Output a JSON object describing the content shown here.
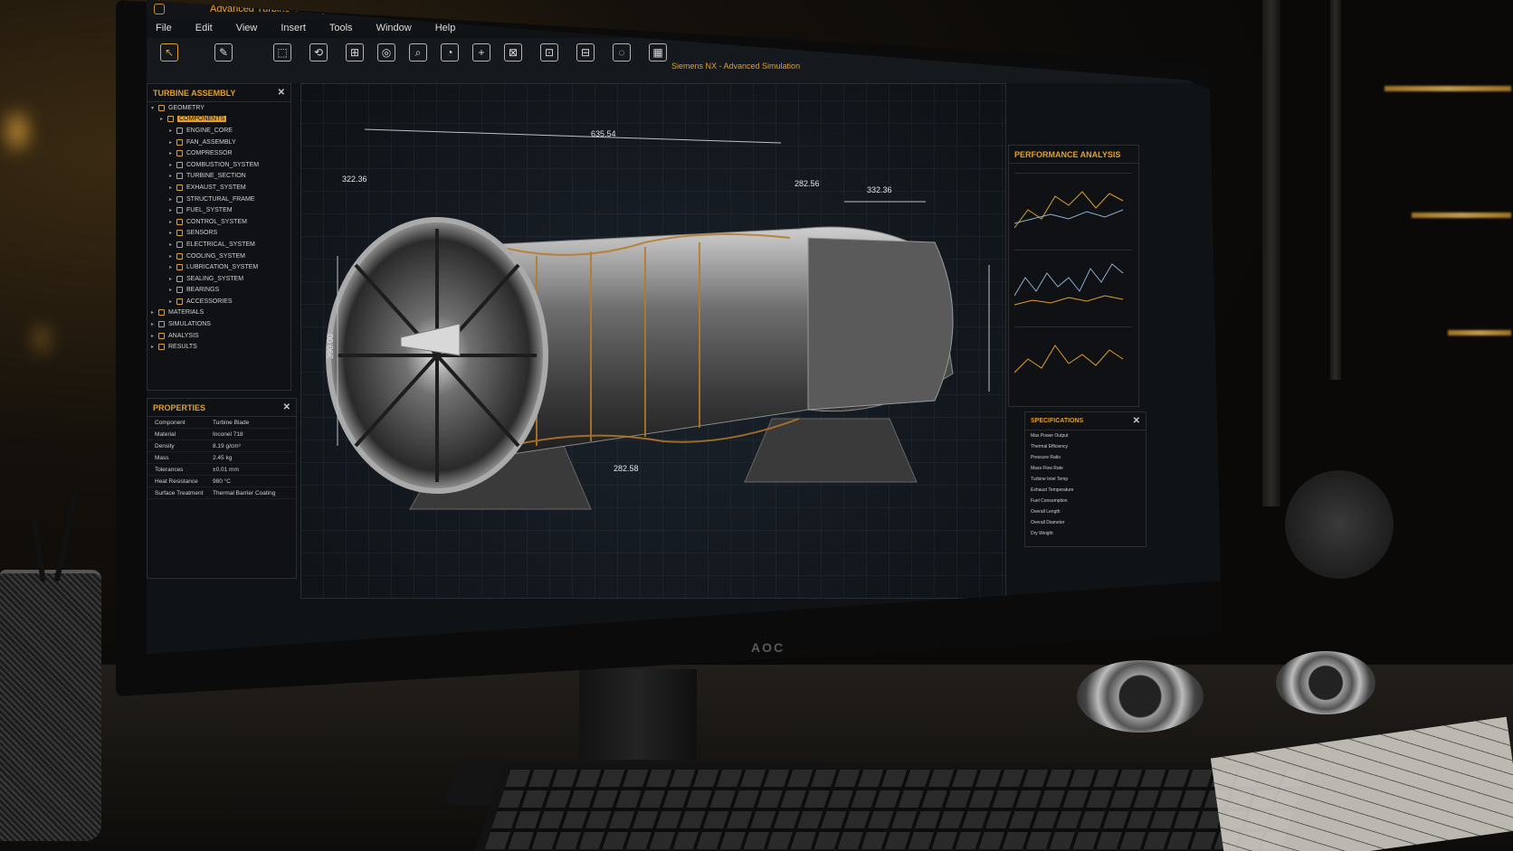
{
  "window": {
    "title": "Advanced Turbine Conceptual Design",
    "subtitle": "Siemens NX - Advanced Simulation"
  },
  "menu": [
    "File",
    "Edit",
    "View",
    "Insert",
    "Tools",
    "Window",
    "Help"
  ],
  "tree": {
    "title": "TURBINE ASSEMBLY",
    "items": [
      {
        "label": "GEOMETRY",
        "level": 0,
        "expanded": true
      },
      {
        "label": "COMPONENTS",
        "level": 1,
        "selected": true
      },
      {
        "label": "ENGINE_CORE",
        "level": 2
      },
      {
        "label": "FAN_ASSEMBLY",
        "level": 2
      },
      {
        "label": "COMPRESSOR",
        "level": 2
      },
      {
        "label": "COMBUSTION_SYSTEM",
        "level": 2
      },
      {
        "label": "TURBINE_SECTION",
        "level": 2
      },
      {
        "label": "EXHAUST_SYSTEM",
        "level": 2
      },
      {
        "label": "STRUCTURAL_FRAME",
        "level": 2
      },
      {
        "label": "FUEL_SYSTEM",
        "level": 2
      },
      {
        "label": "CONTROL_SYSTEM",
        "level": 2
      },
      {
        "label": "SENSORS",
        "level": 2
      },
      {
        "label": "ELECTRICAL_SYSTEM",
        "level": 2
      },
      {
        "label": "COOLING_SYSTEM",
        "level": 2
      },
      {
        "label": "LUBRICATION_SYSTEM",
        "level": 2
      },
      {
        "label": "SEALING_SYSTEM",
        "level": 2
      },
      {
        "label": "BEARINGS",
        "level": 2
      },
      {
        "label": "ACCESSORIES",
        "level": 2
      },
      {
        "label": "MATERIALS",
        "level": 0
      },
      {
        "label": "SIMULATIONS",
        "level": 0
      },
      {
        "label": "ANALYSIS",
        "level": 0
      },
      {
        "label": "RESULTS",
        "level": 0
      }
    ]
  },
  "properties": {
    "title": "PROPERTIES",
    "rows": [
      {
        "k": "Component",
        "v": "Turbine Blade"
      },
      {
        "k": "Material",
        "v": "Inconel 718"
      },
      {
        "k": "Density",
        "v": "8.19 g/cm³"
      },
      {
        "k": "Mass",
        "v": "2.45 kg"
      },
      {
        "k": "Tolerances",
        "v": "±0.01 mm"
      },
      {
        "k": "Heat Resistance",
        "v": "980 °C"
      },
      {
        "k": "Surface Treatment",
        "v": "Thermal Barrier Coating"
      }
    ]
  },
  "viewport": {
    "dims": [
      "635.54",
      "322.36",
      "332.36",
      "282.56",
      "390.00",
      "282.58"
    ]
  },
  "performance": {
    "title": "PERFORMANCE ANALYSIS"
  },
  "specs": {
    "title": "SPECIFICATIONS",
    "rows": [
      "Max Power Output",
      "Thermal Efficiency",
      "Pressure Ratio",
      "Mass Flow Rate",
      "Turbine Inlet Temp",
      "Exhaust Temperature",
      "Fuel Consumption",
      "Overall Length",
      "Overall Diameter",
      "Dry Weight"
    ]
  },
  "monitor_brand": "AOC",
  "colors": {
    "accent": "#e0a030",
    "panel": "#0f1114"
  }
}
